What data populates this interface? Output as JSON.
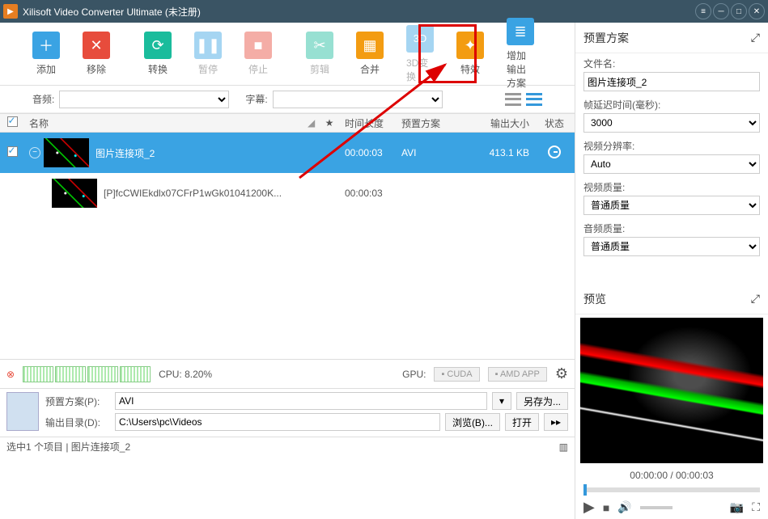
{
  "titlebar": {
    "app": "Xilisoft Video Converter Ultimate (未注册)"
  },
  "toolbar": {
    "add": "添加",
    "remove": "移除",
    "convert": "转换",
    "pause": "暂停",
    "stop": "停止",
    "clip": "剪辑",
    "merge": "合并",
    "3d": "3D变换",
    "effect": "特效",
    "addprofile": "增加输出方案"
  },
  "filter": {
    "audio": "音频:",
    "subtitle": "字幕:"
  },
  "columns": {
    "name": "名称",
    "duration": "时间长度",
    "preset": "预置方案",
    "size": "输出大小",
    "status": "状态"
  },
  "files": [
    {
      "name": "图片连接项_2",
      "dur": "00:00:03",
      "preset": "AVI",
      "size": "413.1 KB"
    },
    {
      "name": "[P]fcCWIEkdlx07CFrP1wGk01041200K...",
      "dur": "00:00:03"
    }
  ],
  "cpu": {
    "label": "CPU: 8.20%",
    "gpu": "GPU:",
    "cuda": "CUDA",
    "amd": "AMD APP"
  },
  "output": {
    "preset_label": "预置方案(P):",
    "preset_value": "AVI",
    "dir_label": "输出目录(D):",
    "dir_value": "C:\\Users\\pc\\Videos",
    "browse": "浏览(B)...",
    "saveas": "另存为...",
    "open": "打开"
  },
  "status": "选中1 个项目 | 图片连接项_2",
  "right": {
    "profile": "预置方案",
    "filename": "文件名:",
    "filename_value": "图片连接项_2",
    "delay": "帧延迟时间(毫秒):",
    "delay_value": "3000",
    "res": "视频分辨率:",
    "res_value": "Auto",
    "vq": "视频质量:",
    "vq_value": "普通质量",
    "aq": "音频质量:",
    "aq_value": "普通质量",
    "preview": "预览",
    "time": "00:00:00 / 00:00:03"
  }
}
